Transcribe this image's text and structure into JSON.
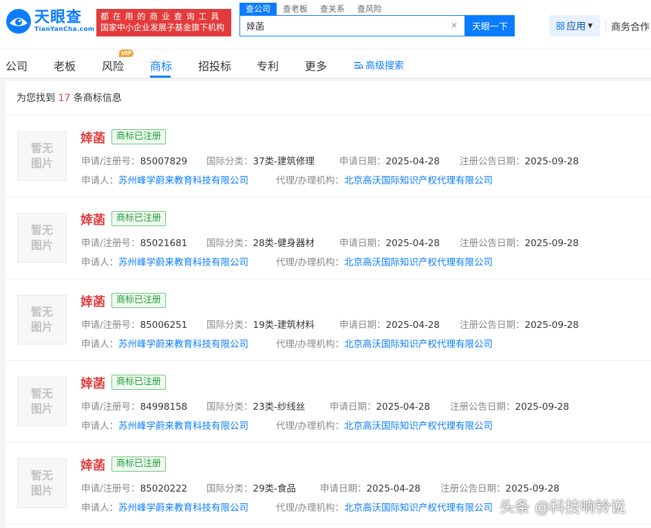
{
  "brand": {
    "logo_cn": "天眼查",
    "logo_en": "TianYanCha.com",
    "slogan_line1": "都在用的商业查询工具",
    "slogan_line2": "国家中小企业发展子基金旗下机构",
    "color": "#0a7cff"
  },
  "search": {
    "tabs": [
      "查公司",
      "查老板",
      "查关系",
      "查风险"
    ],
    "value": "婞菡",
    "button": "天眼一下"
  },
  "header": {
    "app_label": "应用",
    "biz_label": "商务合作"
  },
  "nav": {
    "items": [
      "公司",
      "老板",
      "风险",
      "商标",
      "招投标",
      "专利",
      "更多"
    ],
    "active": "商标",
    "vip": "VIP",
    "advanced": "高级搜索"
  },
  "results": {
    "prefix": "为您找到",
    "count": "17",
    "suffix": "条商标信息",
    "labels": {
      "reg_no": "申请/注册号：",
      "class": "国际分类：",
      "apply_date": "申请日期：",
      "pub_date": "注册公告日期：",
      "applicant": "申请人：",
      "agent": "代理/办理机构："
    },
    "placeholder_line1": "暂无",
    "placeholder_line2": "图片",
    "items": [
      {
        "name": "婞菡",
        "status": "商标已注册",
        "reg_no": "85007829",
        "class": "37类-建筑修理",
        "apply_date": "2025-04-28",
        "pub_date": "2025-09-28",
        "applicant": "苏州峰学蔚来教育科技有限公司",
        "agent": "北京高沃国际知识产权代理有限公司"
      },
      {
        "name": "婞菡",
        "status": "商标已注册",
        "reg_no": "85021681",
        "class": "28类-健身器材",
        "apply_date": "2025-04-28",
        "pub_date": "2025-09-28",
        "applicant": "苏州峰学蔚来教育科技有限公司",
        "agent": "北京高沃国际知识产权代理有限公司"
      },
      {
        "name": "婞菡",
        "status": "商标已注册",
        "reg_no": "85006251",
        "class": "19类-建筑材料",
        "apply_date": "2025-04-28",
        "pub_date": "2025-09-28",
        "applicant": "苏州峰学蔚来教育科技有限公司",
        "agent": "北京高沃国际知识产权代理有限公司"
      },
      {
        "name": "婞菡",
        "status": "商标已注册",
        "reg_no": "84998158",
        "class": "23类-纱线丝",
        "apply_date": "2025-04-28",
        "pub_date": "2025-09-28",
        "applicant": "苏州峰学蔚来教育科技有限公司",
        "agent": "北京高沃国际知识产权代理有限公司"
      },
      {
        "name": "婞菡",
        "status": "商标已注册",
        "reg_no": "85020222",
        "class": "29类-食品",
        "apply_date": "2025-04-28",
        "pub_date": "2025-09-28",
        "applicant": "苏州峰学蔚来教育科技有限公司",
        "agent": "北京高沃国际知识产权代理有限公司"
      }
    ]
  },
  "watermark": "头条 @科技响铃说"
}
